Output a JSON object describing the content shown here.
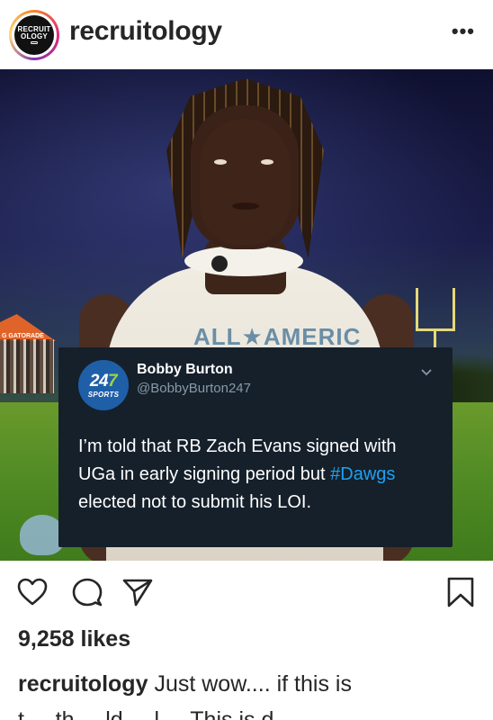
{
  "header": {
    "username": "recruitology",
    "avatar_text_line1": "RECRUIT",
    "avatar_text_line2": "OLOGY",
    "more_label": "•••"
  },
  "photo": {
    "jersey_text": "ALL★AMERIC",
    "tent_label": "G GATORADE"
  },
  "tweet": {
    "avatar_num_a": "24",
    "avatar_num_b": "7",
    "avatar_sports": "SPORTS",
    "display_name": "Bobby Burton",
    "handle": "@BobbyBurton247",
    "text_before": "I’m told that RB Zach Evans signed with UGa in early signing period but ",
    "hashtag": "#Dawgs",
    "text_after": " elected not to submit his LOI."
  },
  "actions": {
    "like_icon": "heart-icon",
    "comment_icon": "comment-icon",
    "share_icon": "paper-plane-icon",
    "save_icon": "bookmark-icon"
  },
  "post": {
    "likes": "9,258 likes",
    "caption_user": "recruitology",
    "caption_text": "Just wow.... if this is",
    "caption_cut": "t ... th ... ld ... l ... This is d"
  }
}
